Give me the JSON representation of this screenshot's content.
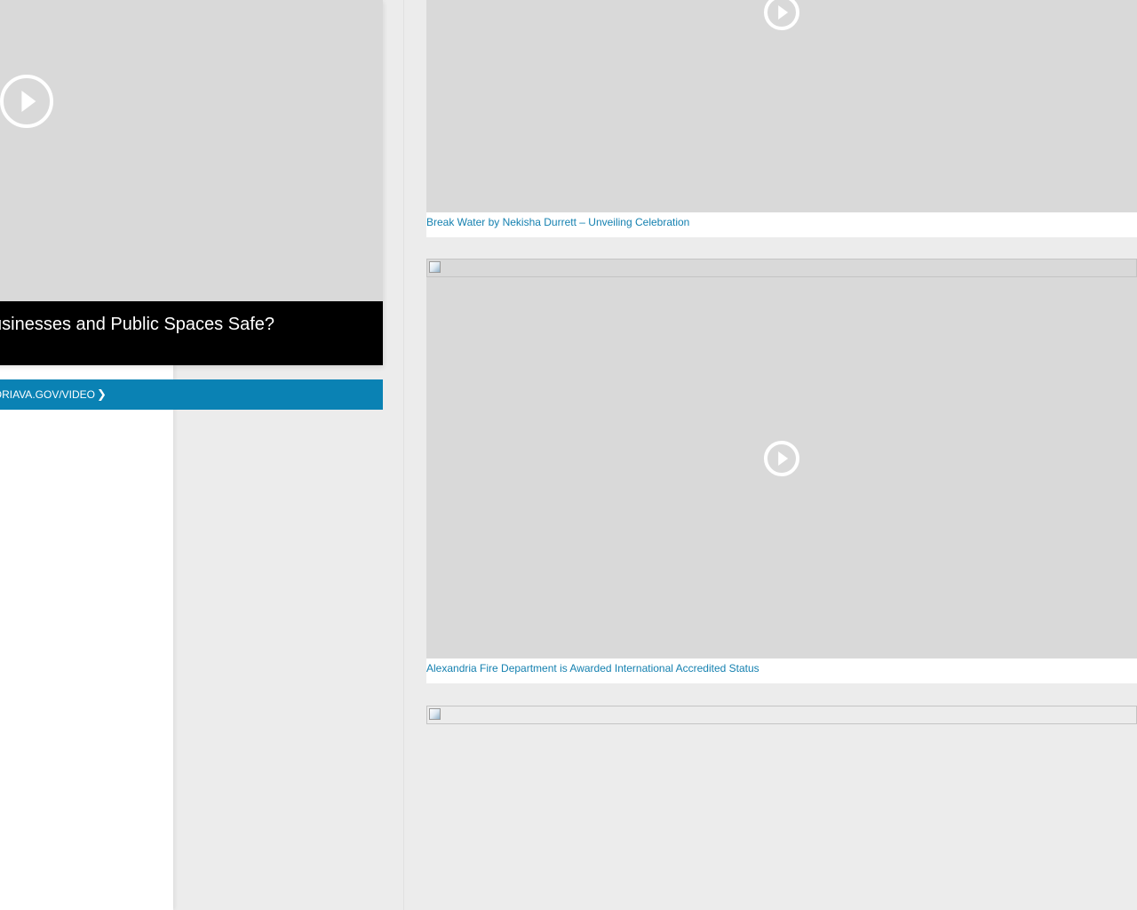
{
  "featured": {
    "caption": "Businesses and Public Spaces Safe?",
    "play_icon": "play-circle-icon"
  },
  "more_link": {
    "label": "ORIAVA.GOV/VIDEO",
    "icon": "chevron-right-icon"
  },
  "videos": [
    {
      "title": "Break Water by Nekisha Durrett – Unveiling Celebration",
      "icon": "play-circle-icon"
    },
    {
      "title": "Alexandria Fire Department is Awarded International Accredited Status",
      "icon": "play-circle-icon"
    }
  ],
  "colors": {
    "accent": "#0a82b4",
    "link": "#1581b0",
    "caption_bar": "#000000",
    "thumb_placeholder": "#d9d9d9",
    "page_bg": "#ececec"
  }
}
